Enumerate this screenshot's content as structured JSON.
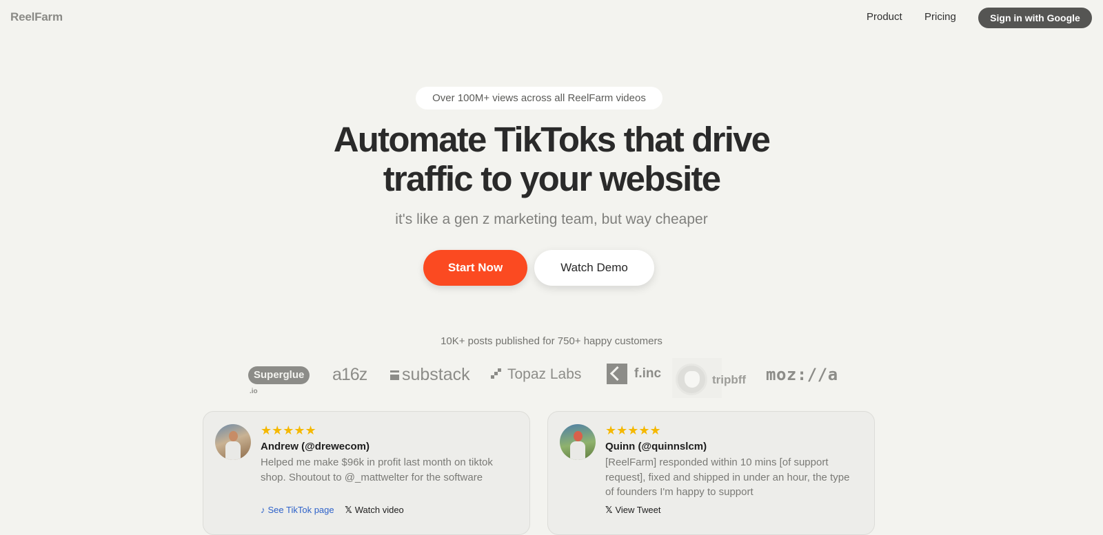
{
  "nav": {
    "brand": "ReelFarm",
    "product": "Product",
    "pricing": "Pricing",
    "signin": "Sign in with Google"
  },
  "hero": {
    "pill": "Over 100M+ views across all ReelFarm videos",
    "headline_line1": "Automate TikToks that drive",
    "headline_line2": "traffic to your website",
    "subheadline": "it's like a gen z marketing team, but way cheaper",
    "cta_primary": "Start Now",
    "cta_secondary": "Watch Demo"
  },
  "social_proof": {
    "text": "10K+ posts published for 750+ happy customers",
    "logos": {
      "superglue": "Superglue",
      "superglue_suffix": ".io",
      "a16z": "a16z",
      "substack": "substack",
      "topaz": "Topaz Labs",
      "finc": "f.inc",
      "tripbff": "tripbff",
      "mozilla": "moz://a"
    }
  },
  "testimonials": [
    {
      "stars": "★★★★★",
      "name": "Andrew (@drewecom)",
      "quote": "Helped me make $96k in profit last month on tiktok shop. Shoutout to @_mattwelter for the software",
      "link1": "See TikTok page",
      "link2": "Watch video"
    },
    {
      "stars": "★★★★★",
      "name": "Quinn (@quinnslcm)",
      "quote": "[ReelFarm] responded within 10 mins [of support request], fixed and shipped in under an hour, the type of founders I'm happy to support",
      "link1": "View Tweet"
    }
  ],
  "colors": {
    "background": "#f3f3ef",
    "accent": "#fb4a21",
    "signin_bg": "#555553",
    "stars": "#f5b800",
    "link_blue": "#2e62c9"
  }
}
